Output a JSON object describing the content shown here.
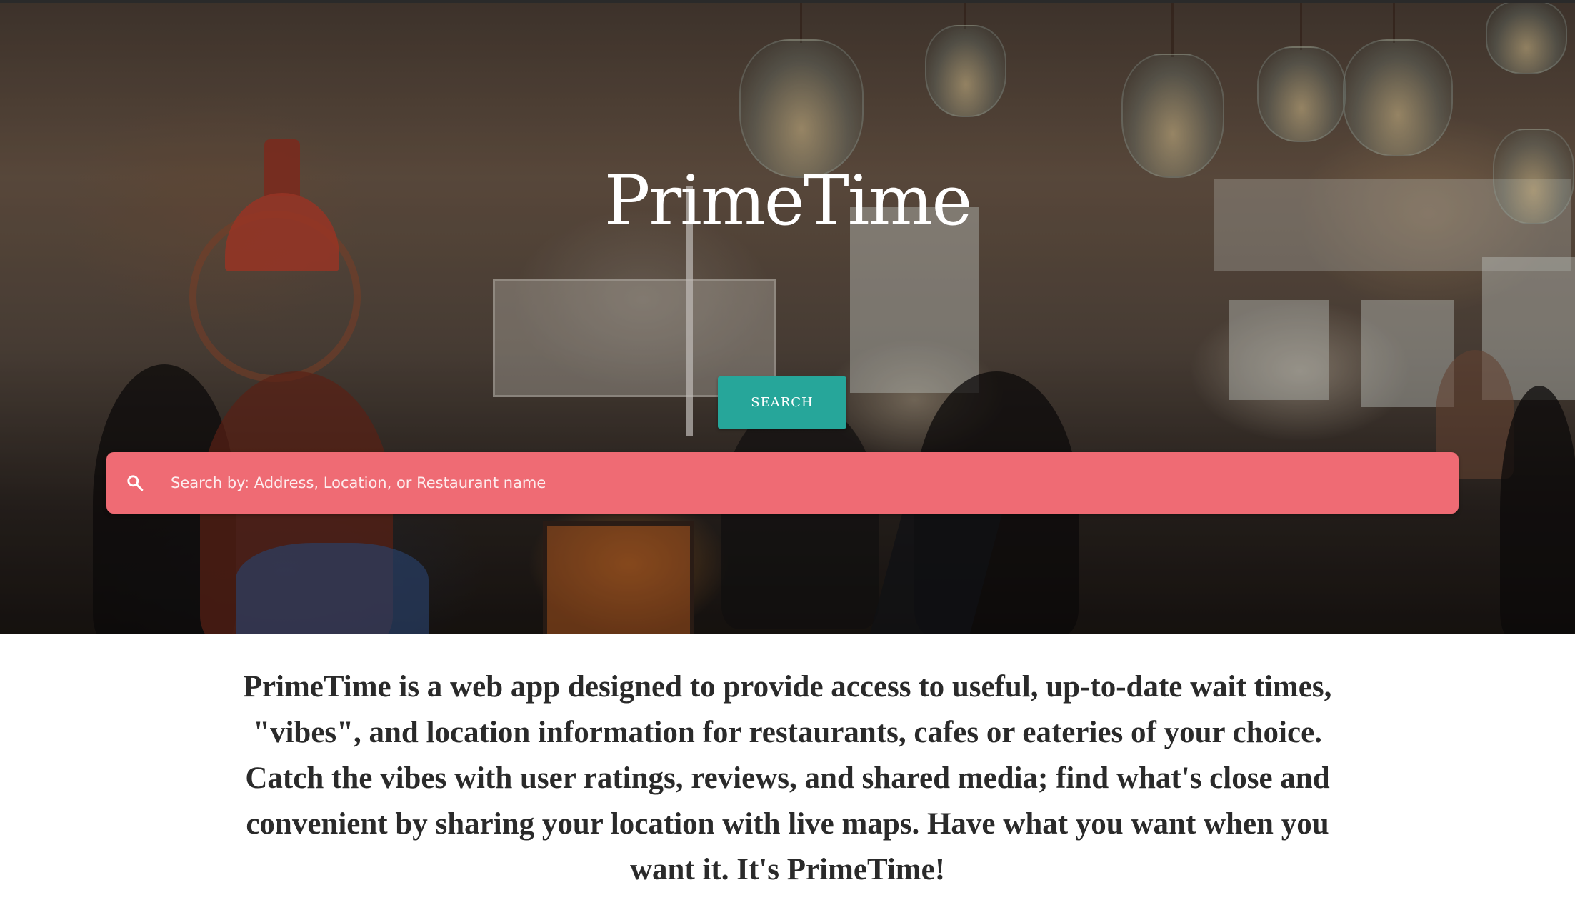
{
  "hero": {
    "title": "PrimeTime",
    "search_button_label": "SEARCH",
    "background": "restaurant interior photo"
  },
  "search": {
    "placeholder": "Search by: Address, Location, or Restaurant name",
    "value": "",
    "icon": "search-icon"
  },
  "description": {
    "text": "PrimeTime is a web app designed to provide access to useful, up-to-date wait times, \"vibes\", and location information for restaurants, cafes or eateries of your choice. Catch the vibes with user ratings, reviews, and shared media; find what's close and convenient by sharing your location with live maps. Have what you want when you want it. It's PrimeTime!"
  },
  "colors": {
    "search_button": "#26a69a",
    "search_bar": "#ef6b74",
    "title_text": "#ffffff",
    "body_text": "#2a2a2a"
  }
}
